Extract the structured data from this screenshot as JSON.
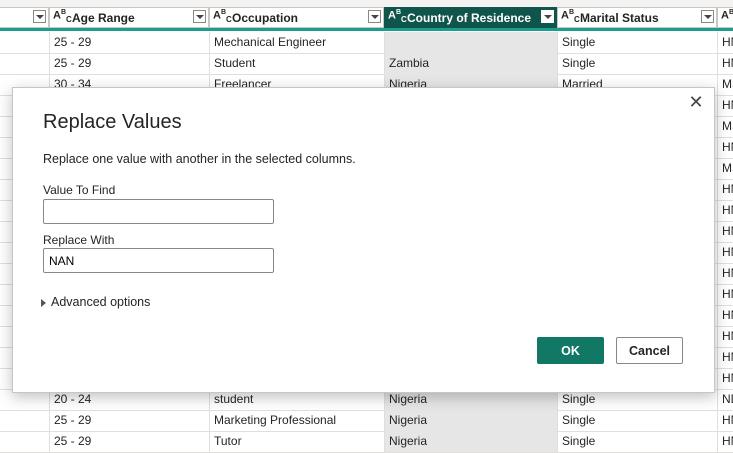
{
  "columns": [
    {
      "type_icon": "ABC",
      "name": "Age Range"
    },
    {
      "type_icon": "ABC",
      "name": "Occupation"
    },
    {
      "type_icon": "ABC",
      "name": "Country of Residence"
    },
    {
      "type_icon": "ABC",
      "name": "Marital Status"
    },
    {
      "type_icon": "ABC",
      "name": ""
    }
  ],
  "rows": [
    [
      "25 - 29",
      "Mechanical Engineer",
      "",
      "Single",
      "HN"
    ],
    [
      "25 - 29",
      "Student",
      "Zambia",
      "Single",
      "HN"
    ],
    [
      "30 - 34",
      "Freelancer",
      "Nigeria",
      "Married",
      "MS"
    ],
    [
      "",
      "",
      "",
      "",
      "HN"
    ],
    [
      "",
      "",
      "",
      "",
      "MS"
    ],
    [
      "",
      "",
      "",
      "",
      "HN"
    ],
    [
      "",
      "",
      "",
      "",
      "MS"
    ],
    [
      "",
      "",
      "",
      "",
      "HN"
    ],
    [
      "",
      "",
      "",
      "",
      "HN"
    ],
    [
      "",
      "",
      "",
      "",
      "HN"
    ],
    [
      "",
      "",
      "",
      "",
      "HN"
    ],
    [
      "",
      "",
      "",
      "",
      "HN"
    ],
    [
      "",
      "",
      "",
      "",
      "HN"
    ],
    [
      "",
      "",
      "",
      "",
      "HN"
    ],
    [
      "",
      "",
      "",
      "",
      "HN"
    ],
    [
      "",
      "",
      "",
      "",
      "HN"
    ],
    [
      "",
      "",
      "",
      "",
      "HN"
    ],
    [
      "20 - 24",
      "student",
      "Nigeria",
      "Single",
      "ND"
    ],
    [
      "25 - 29",
      "Marketing Professional",
      "Nigeria",
      "Single",
      "HN"
    ],
    [
      "25 - 29",
      "Tutor",
      "Nigeria",
      "Single",
      "HN"
    ]
  ],
  "dialog": {
    "title": "Replace Values",
    "description": "Replace one value with another in the selected columns.",
    "find_label": "Value To Find",
    "find_value": "",
    "replace_label": "Replace With",
    "replace_value": "NAN",
    "advanced_label": "Advanced options",
    "ok_label": "OK",
    "cancel_label": "Cancel",
    "close_icon": "close-icon"
  },
  "colors": {
    "selected_header": "#10554c",
    "ok_button": "#117865",
    "accent_bar": "#1b9e8f"
  }
}
